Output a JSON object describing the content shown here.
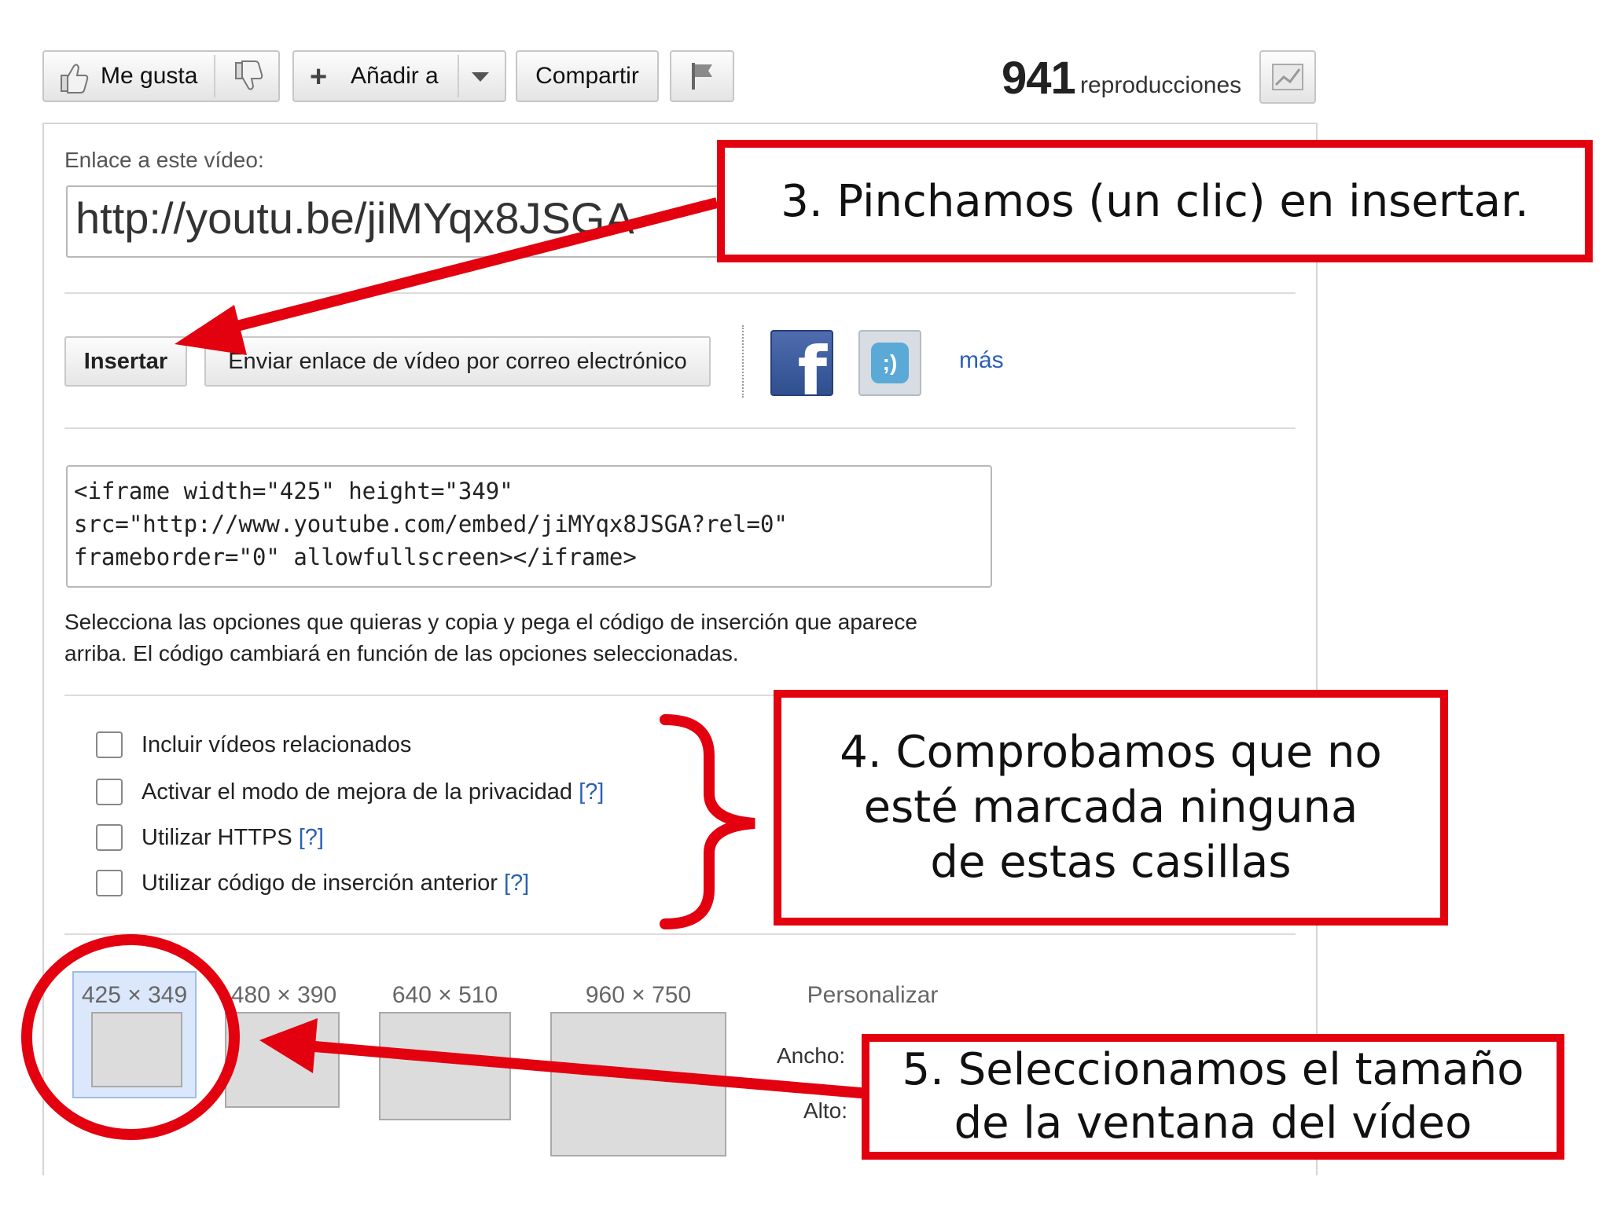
{
  "toolbar": {
    "like_label": "Me gusta",
    "add_label": "Añadir a",
    "share_label": "Compartir",
    "views_count": "941",
    "views_label": "reproducciones"
  },
  "share_panel": {
    "link_label": "Enlace a este vídeo:",
    "link_value": "http://youtu.be/jiMYqx8JSGA",
    "embed_tab_label": "Insertar",
    "email_tab_label": "Enviar enlace de vídeo por correo electrónico",
    "more_label": "más"
  },
  "embed": {
    "code_lines": [
      "<iframe width=\"425\" height=\"349\"",
      "src=\"http://www.youtube.com/embed/jiMYqx8JSGA?rel=0\"",
      "frameborder=\"0\" allowfullscreen></iframe>"
    ],
    "description_lines": [
      "Selecciona las opciones que quieras y copia y pega el código de inserción que aparece",
      "arriba. El código cambiará en función de las opciones seleccionadas."
    ],
    "help_marker": "[?]",
    "options": [
      {
        "label": "Incluir vídeos relacionados",
        "checked": false,
        "help": false
      },
      {
        "label": "Activar el modo de mejora de la privacidad",
        "checked": false,
        "help": true
      },
      {
        "label": "Utilizar HTTPS",
        "checked": false,
        "help": true
      },
      {
        "label": "Utilizar código de inserción anterior",
        "checked": false,
        "help": true
      }
    ],
    "sizes": [
      {
        "label": "425 × 349",
        "selected": true
      },
      {
        "label": "480 × 390",
        "selected": false
      },
      {
        "label": "640 × 510",
        "selected": false
      },
      {
        "label": "960 × 750",
        "selected": false
      }
    ],
    "custom_label": "Personalizar",
    "width_label": "Ancho:",
    "height_label": "Alto:"
  },
  "annotations": {
    "step3": [
      "3. Pinchamos (un clic) en insertar."
    ],
    "step4": [
      "4. Comprobamos que no",
      "esté marcada ninguna",
      "de estas casillas"
    ],
    "step5": [
      "5. Seleccionamos el tamaño",
      "de la ventana del vídeo"
    ]
  },
  "colors": {
    "annotation_red": "#e3000f",
    "facebook_blue": "#3b5998",
    "tuenti_blue": "#5aa9d6",
    "link_blue": "#2b5fb8",
    "selected_size_bg": "#dbe8fb"
  }
}
